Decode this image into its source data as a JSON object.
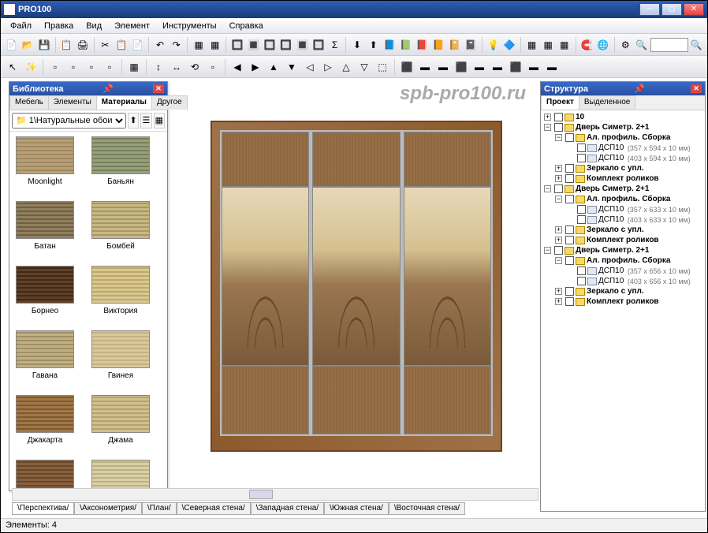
{
  "title": "PRO100",
  "menu": [
    "Файл",
    "Правка",
    "Вид",
    "Элемент",
    "Инструменты",
    "Справка"
  ],
  "watermark": "spb-pro100.ru",
  "library": {
    "title": "Библиотека",
    "tabs": [
      "Мебель",
      "Элементы",
      "Материалы",
      "Другое"
    ],
    "active_tab": "Материалы",
    "path": "1\\Натуральные обои",
    "items": [
      {
        "name": "Moonlight",
        "c1": "#b8a078",
        "c2": "#a08860"
      },
      {
        "name": "Баньян",
        "c1": "#98a080",
        "c2": "#788058"
      },
      {
        "name": "Батан",
        "c1": "#908060",
        "c2": "#706040"
      },
      {
        "name": "Бомбей",
        "c1": "#c8b888",
        "c2": "#a89860"
      },
      {
        "name": "Борнео",
        "c1": "#604028",
        "c2": "#402818"
      },
      {
        "name": "Виктория",
        "c1": "#d8c890",
        "c2": "#c0a868"
      },
      {
        "name": "Гавана",
        "c1": "#c0b088",
        "c2": "#a09060"
      },
      {
        "name": "Гвинея",
        "c1": "#d8c8a0",
        "c2": "#c8b080"
      },
      {
        "name": "Джакарта",
        "c1": "#a07848",
        "c2": "#805830"
      },
      {
        "name": "Джама",
        "c1": "#d0c090",
        "c2": "#b8a070"
      },
      {
        "name": "",
        "c1": "#886040",
        "c2": "#684828"
      },
      {
        "name": "",
        "c1": "#d8d0a8",
        "c2": "#c0b080"
      }
    ]
  },
  "structure": {
    "title": "Структура",
    "tabs": [
      "Проект",
      "Выделенное"
    ],
    "active_tab": "Проект",
    "nodes": [
      {
        "l": 0,
        "exp": "+",
        "bold": true,
        "txt": "10"
      },
      {
        "l": 0,
        "exp": "−",
        "bold": true,
        "txt": "Дверь Симетр. 2+1"
      },
      {
        "l": 1,
        "exp": "−",
        "bold": true,
        "txt": "Ал. профиль. Сборка"
      },
      {
        "l": 2,
        "exp": "",
        "leaf": true,
        "txt": "ДСП10",
        "dim": "(357 x 594 x 10 мм)"
      },
      {
        "l": 2,
        "exp": "",
        "leaf": true,
        "txt": "ДСП10",
        "dim": "(403 x 594 x 10 мм)"
      },
      {
        "l": 1,
        "exp": "+",
        "bold": true,
        "txt": "Зеркало с упл."
      },
      {
        "l": 1,
        "exp": "+",
        "bold": true,
        "txt": "Комплект роликов"
      },
      {
        "l": 0,
        "exp": "−",
        "bold": true,
        "txt": "Дверь Симетр. 2+1"
      },
      {
        "l": 1,
        "exp": "−",
        "bold": true,
        "txt": "Ал. профиль. Сборка"
      },
      {
        "l": 2,
        "exp": "",
        "leaf": true,
        "txt": "ДСП10",
        "dim": "(357 x 633 x 10 мм)"
      },
      {
        "l": 2,
        "exp": "",
        "leaf": true,
        "txt": "ДСП10",
        "dim": "(403 x 633 x 10 мм)"
      },
      {
        "l": 1,
        "exp": "+",
        "bold": true,
        "txt": "Зеркало с упл."
      },
      {
        "l": 1,
        "exp": "+",
        "bold": true,
        "txt": "Комплект роликов"
      },
      {
        "l": 0,
        "exp": "−",
        "bold": true,
        "txt": "Дверь Симетр. 2+1"
      },
      {
        "l": 1,
        "exp": "−",
        "bold": true,
        "txt": "Ал. профиль. Сборка"
      },
      {
        "l": 2,
        "exp": "",
        "leaf": true,
        "txt": "ДСП10",
        "dim": "(357 x 656 x 10 мм)"
      },
      {
        "l": 2,
        "exp": "",
        "leaf": true,
        "txt": "ДСП10",
        "dim": "(403 x 656 x 10 мм)"
      },
      {
        "l": 1,
        "exp": "+",
        "bold": true,
        "txt": "Зеркало с упл."
      },
      {
        "l": 1,
        "exp": "+",
        "bold": true,
        "txt": "Комплект роликов"
      }
    ]
  },
  "viewtabs": [
    "Перспектива",
    "Аксонометрия",
    "План",
    "Северная стена",
    "Западная стена",
    "Южная стена",
    "Восточная стена"
  ],
  "active_viewtab": "Перспектива",
  "status": "Элементы: 4",
  "toolbar1": [
    "📄",
    "📂",
    "💾",
    "",
    "📋",
    "🖨",
    "",
    "✂",
    "📋",
    "📄",
    "",
    "↶",
    "↷",
    "",
    "▦",
    "▦",
    "",
    "🔲",
    "🔳",
    "🔲",
    "🔲",
    "🔳",
    "🔲",
    "Σ",
    "",
    "⬇",
    "⬆",
    "📘",
    "📗",
    "📕",
    "📙",
    "📔",
    "📓",
    "",
    "💡",
    "🔷",
    "",
    "▦",
    "▦",
    "▦",
    "",
    "🧲",
    "🌐",
    "",
    "⚙",
    "🔍"
  ],
  "toolbar2": [
    "↖",
    "✨",
    "",
    "▫",
    "▫",
    "▫",
    "▫",
    "",
    "▦",
    "",
    "↕",
    "↔",
    "⟲",
    "▫",
    "",
    "◀",
    "▶",
    "▲",
    "▼",
    "◁",
    "▷",
    "△",
    "▽",
    "⬚",
    "",
    "⬛",
    "▬",
    "▬",
    "⬛",
    "▬",
    "▬",
    "⬛",
    "▬",
    "▬"
  ]
}
